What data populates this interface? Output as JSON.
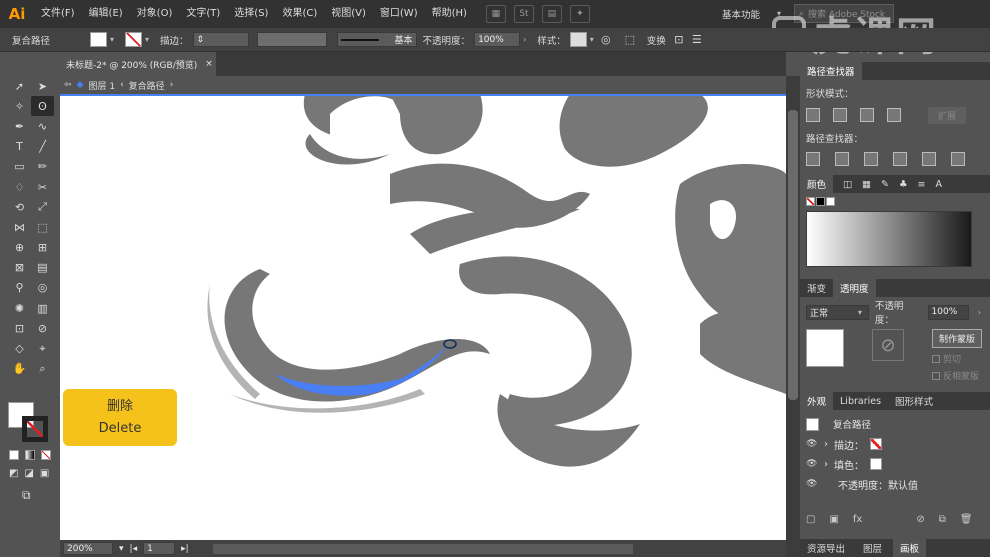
{
  "app": {
    "logo": "Ai"
  },
  "menubar": {
    "items": [
      "文件(F)",
      "编辑(E)",
      "对象(O)",
      "文字(T)",
      "选择(S)",
      "效果(C)",
      "视图(V)",
      "窗口(W)",
      "帮助(H)"
    ],
    "workspace": "基本功能",
    "stock_search_placeholder": "搜索 Adobe Stock",
    "watermark": "虎课网"
  },
  "controlbar": {
    "object_label": "复合路径",
    "stroke_label": "描边：",
    "stroke_style": "基本",
    "opacity_label": "不透明度：",
    "opacity_value": "100%",
    "style_label": "样式：",
    "transform_label": "变换"
  },
  "document": {
    "tab_title": "未标题-2* @ 200% (RGB/预览)",
    "breadcrumb_layer": "图层 1",
    "breadcrumb_object": "复合路径",
    "zoom": "200%",
    "page": "1",
    "artboard_nav": "1"
  },
  "overlay": {
    "title": "删除",
    "subtitle": "Delete"
  },
  "panels": {
    "pathfinder": {
      "title": "路径查找器",
      "shape_modes_label": "形状模式：",
      "expand_label": "扩展",
      "pathfinders_label": "路径查找器："
    },
    "color": {
      "tabs": [
        "颜色"
      ]
    },
    "transparency": {
      "tabs": [
        "渐变",
        "透明度"
      ],
      "blend_mode": "正常",
      "opacity_label": "不透明度：",
      "opacity_value": "100%",
      "make_mask_label": "制作蒙版",
      "clip_label": "剪切",
      "invert_label": "反相蒙版"
    },
    "appearance": {
      "tabs": [
        "外观",
        "Libraries",
        "图形样式"
      ],
      "object_name": "复合路径",
      "stroke_label": "描边：",
      "fill_label": "填色：",
      "opacity_row": "不透明度：默认值"
    },
    "bottom_tabs": [
      "资源导出",
      "图层",
      "画板"
    ]
  },
  "colors": {
    "accent": "#4a7ef5",
    "badge": "#f4c21a",
    "ink": "#777777"
  }
}
